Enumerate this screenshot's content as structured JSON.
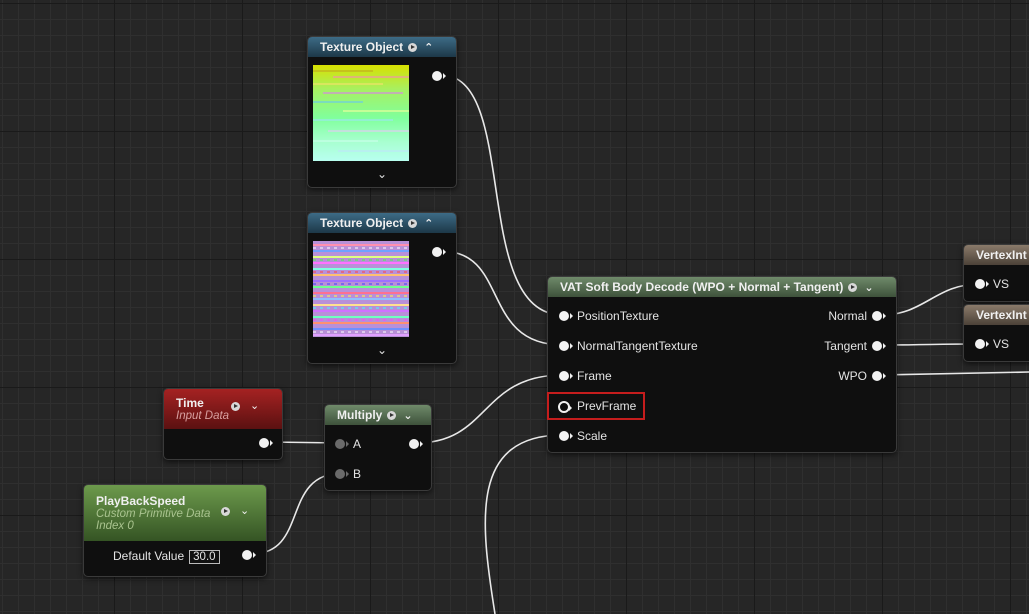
{
  "nodes": {
    "tex1": {
      "title": "Texture Object"
    },
    "tex2": {
      "title": "Texture Object"
    },
    "vat": {
      "title": "VAT Soft Body Decode (WPO + Normal + Tangent)",
      "inputs": [
        "PositionTexture",
        "NormalTangentTexture",
        "Frame",
        "PrevFrame",
        "Scale"
      ],
      "outputs": [
        "Normal",
        "Tangent",
        "WPO"
      ]
    },
    "time": {
      "title": "Time",
      "subtitle": "Input Data"
    },
    "multiply": {
      "title": "Multiply",
      "inputs": [
        "A",
        "B"
      ]
    },
    "playback": {
      "title": "PlayBackSpeed",
      "subtitle1": "Custom Primitive Data",
      "subtitle2": "Index 0",
      "default_label": "Default Value",
      "default_value": "30.0"
    },
    "vi1": {
      "title": "VertexInt",
      "pin": "VS"
    },
    "vi2": {
      "title": "VertexInt",
      "pin": "VS"
    }
  },
  "colors": {
    "texture_header": "#2d566e",
    "vat_header": "#5a7556",
    "time_header": "#8e1a1a",
    "playback_header": "#5a8040",
    "vertexint_header": "#7a6a5a",
    "highlight": "#c51d1d"
  },
  "icons": [
    "preview-toggle-icon",
    "collapse-chevron-icon",
    "expand-chevron-icon"
  ]
}
